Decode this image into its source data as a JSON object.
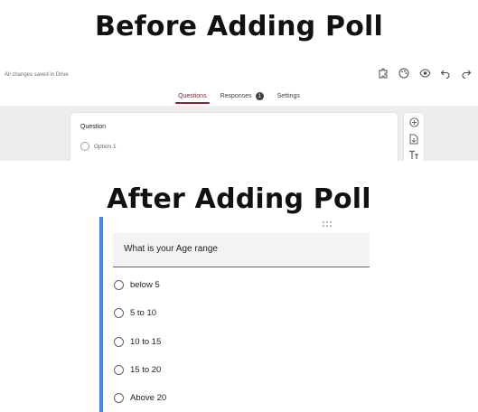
{
  "titles": {
    "before": "Before Adding Poll",
    "after": "After Adding Poll"
  },
  "before": {
    "saved_status": "All changes saved in Drive",
    "toolbar_icons": [
      "addon-icon",
      "palette-icon",
      "preview-eye-icon",
      "undo-icon",
      "redo-icon"
    ],
    "tabs": [
      {
        "label": "Questions",
        "active": true
      },
      {
        "label": "Responses",
        "badge": "1"
      },
      {
        "label": "Settings"
      }
    ],
    "question_card": {
      "label": "Question",
      "option": "Option 1"
    },
    "side_tools": [
      "add-question-icon",
      "import-questions-icon",
      "add-title-icon"
    ]
  },
  "after": {
    "question": "What is your Age range",
    "options": [
      "below 5",
      "5 to 10",
      "10 to 15",
      "15 to 20",
      "Above 20"
    ],
    "accent_color": "#4285f4"
  }
}
